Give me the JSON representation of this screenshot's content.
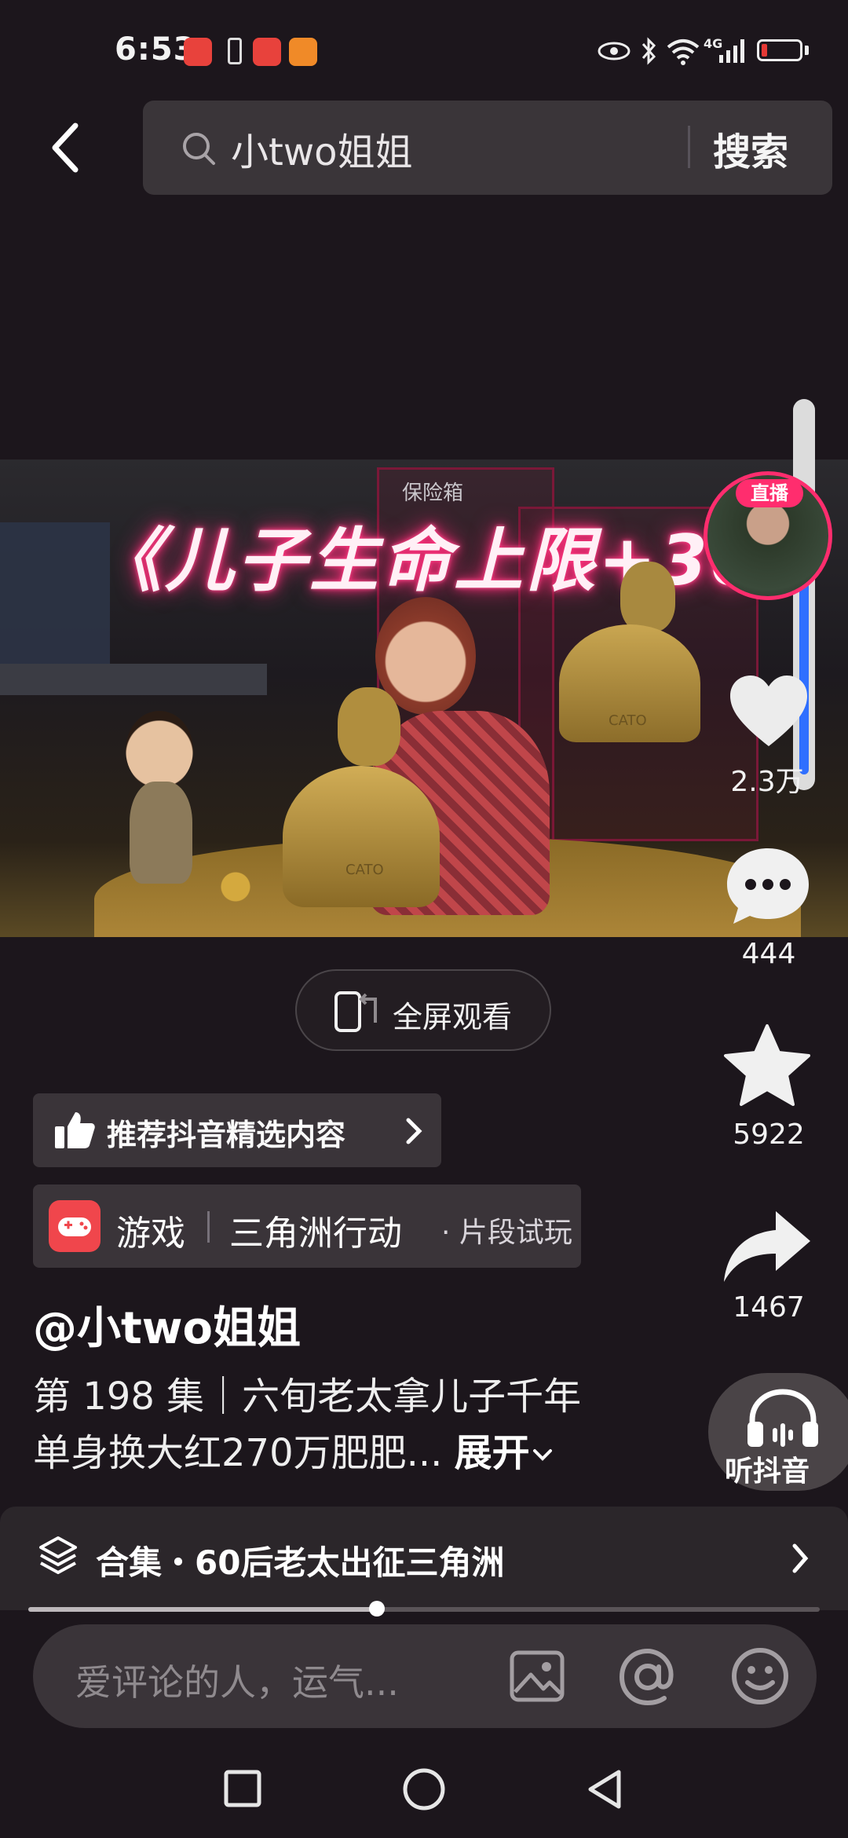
{
  "status_bar": {
    "time": "6:53",
    "network": "4G",
    "colors": {
      "battery_low": "#e53935"
    }
  },
  "header": {
    "search_query": "小two姐姐",
    "search_button": "搜索"
  },
  "video": {
    "overlay_title": "《儿子生命上限+30",
    "sign_label": "保险箱",
    "bust_inscription": "CATO",
    "live_badge": "直播",
    "progress_fraction": 0.36
  },
  "rail": {
    "likes": "2.3万",
    "comments": "444",
    "favorites": "5922",
    "shares": "1467",
    "listen_label": "听抖音"
  },
  "fullscreen_label": "全屏观看",
  "recommend_label": "推荐抖音精选内容",
  "game_tag": {
    "category": "游戏",
    "name": "三角洲行动",
    "sub": "· 片段试玩"
  },
  "author": "@小two姐姐",
  "description": {
    "line1": "第 198 集｜六旬老太拿儿子千年",
    "line2": "单身换大红270万肥肥...",
    "expand": "展开"
  },
  "collection": {
    "label": "合集・60后老太出征三角洲"
  },
  "seek_fraction": 0.44,
  "comment_bar": {
    "placeholder": "爱评论的人，运气..."
  },
  "icons": [
    "back-icon",
    "search-icon",
    "heart-icon",
    "comment-icon",
    "star-icon",
    "share-icon",
    "headphones-icon",
    "layers-icon",
    "chevron-right-icon",
    "image-icon",
    "at-icon",
    "emoji-icon",
    "square-nav-icon",
    "circle-nav-icon",
    "triangle-nav-icon"
  ]
}
